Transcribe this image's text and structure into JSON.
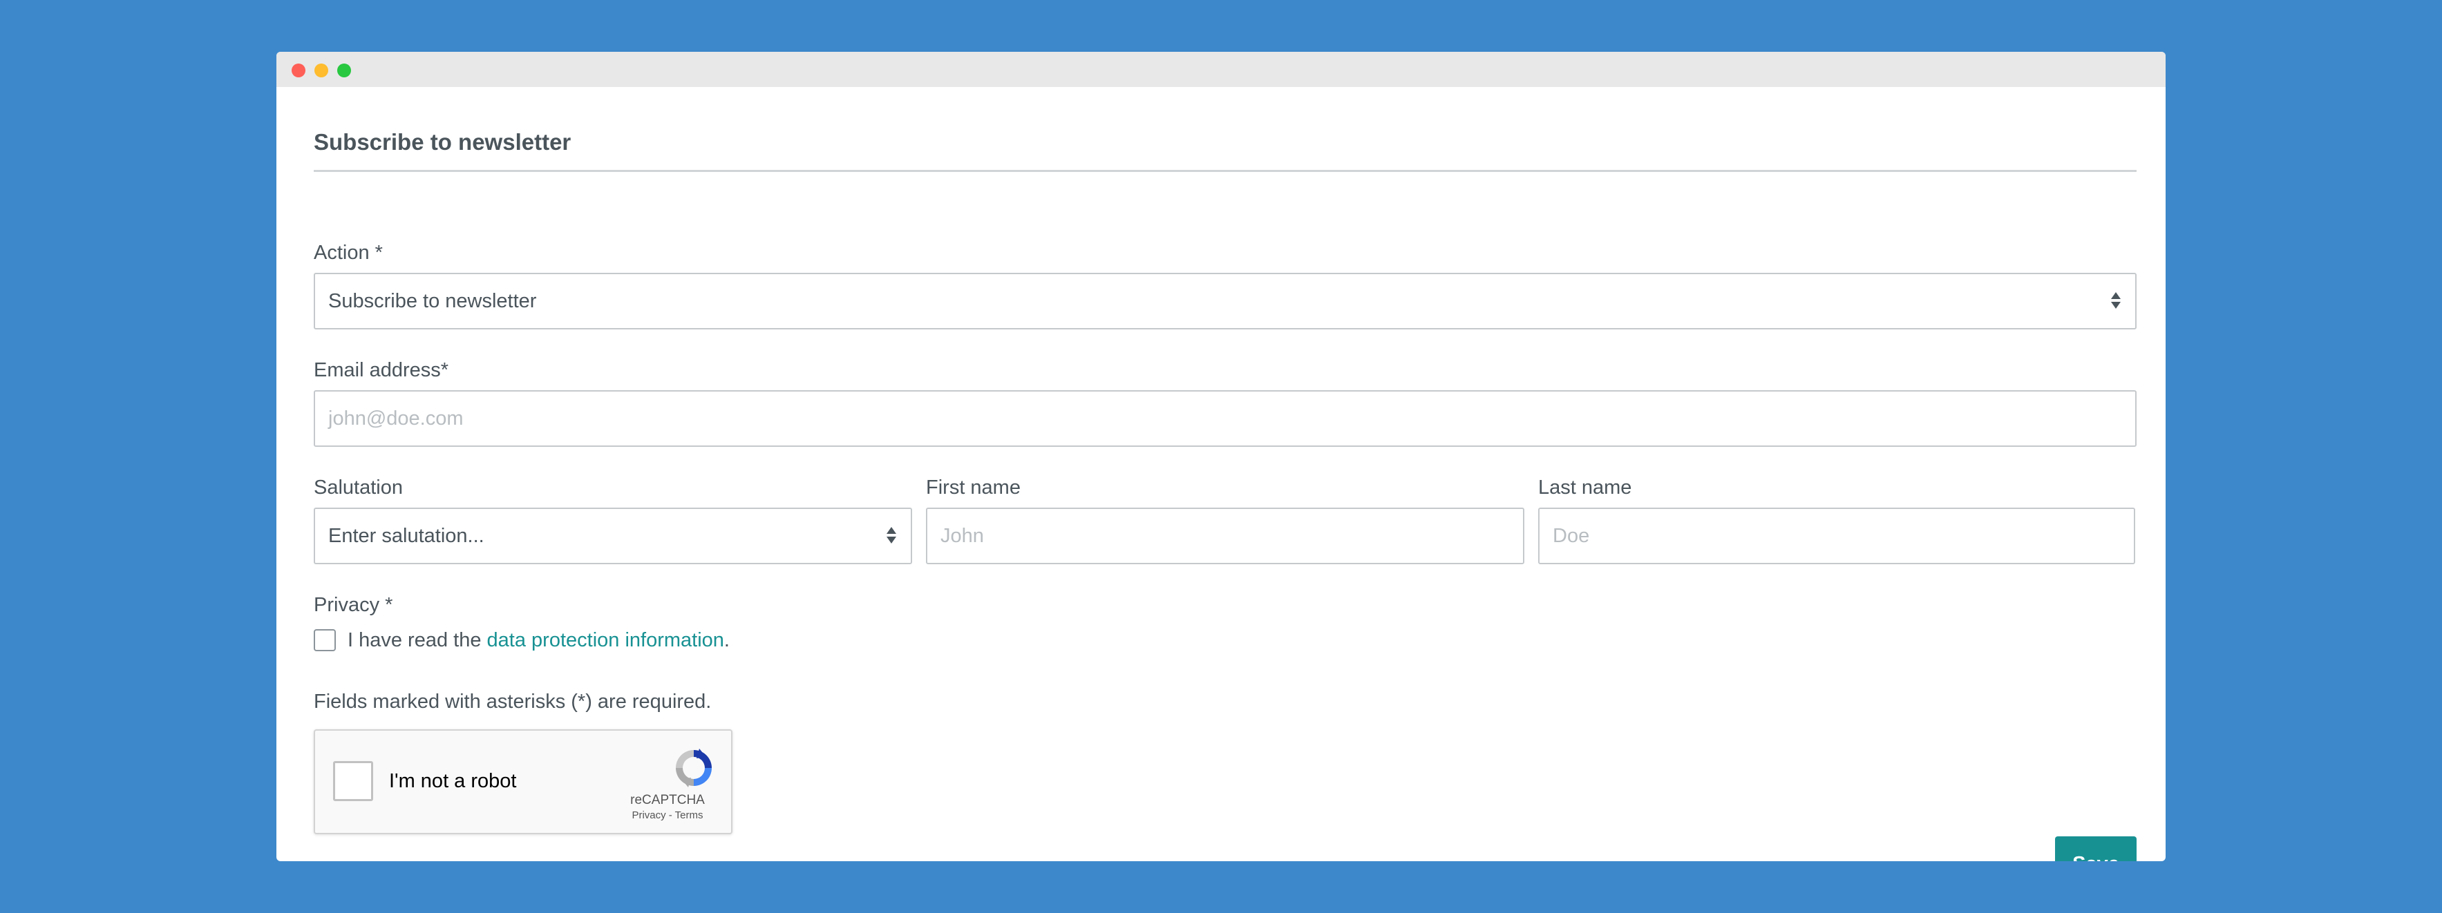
{
  "window": {
    "controls": [
      "close",
      "minimize",
      "maximize"
    ]
  },
  "form": {
    "heading": "Subscribe to newsletter",
    "action": {
      "label": "Action *",
      "value": "Subscribe to newsletter"
    },
    "email": {
      "label": "Email address*",
      "placeholder": "john@doe.com"
    },
    "salutation": {
      "label": "Salutation",
      "value": "Enter salutation..."
    },
    "first_name": {
      "label": "First name",
      "placeholder": "John"
    },
    "last_name": {
      "label": "Last name",
      "placeholder": "Doe"
    },
    "privacy": {
      "label": "Privacy *",
      "text_before": "I have read the ",
      "link_text": "data protection information",
      "text_after": ".",
      "checked": false
    },
    "required_note": "Fields marked with asterisks (*) are required.",
    "recaptcha": {
      "label": "I'm not a robot",
      "brand": "reCAPTCHA",
      "terms": "Privacy - Terms",
      "checked": false
    },
    "save_label": "Save"
  },
  "colors": {
    "background": "#3d88cb",
    "accent": "#189193",
    "text": "#4a545b"
  }
}
